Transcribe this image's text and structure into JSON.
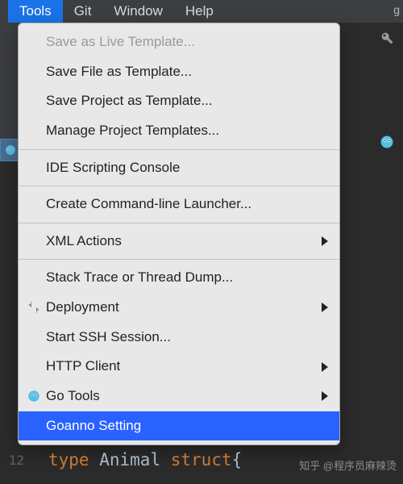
{
  "menubar": {
    "items": [
      {
        "label": "Tools",
        "active": true
      },
      {
        "label": "Git",
        "active": false
      },
      {
        "label": "Window",
        "active": false
      },
      {
        "label": "Help",
        "active": false
      }
    ]
  },
  "dropdown": {
    "items": [
      {
        "label": "Save as Live Template...",
        "disabled": true
      },
      {
        "label": "Save File as Template..."
      },
      {
        "label": "Save Project as Template..."
      },
      {
        "label": "Manage Project Templates..."
      },
      {
        "sep": true
      },
      {
        "label": "IDE Scripting Console"
      },
      {
        "sep": true
      },
      {
        "label": "Create Command-line Launcher..."
      },
      {
        "sep": true
      },
      {
        "label": "XML Actions",
        "submenu": true
      },
      {
        "sep": true
      },
      {
        "label": "Stack Trace or Thread Dump..."
      },
      {
        "label": "Deployment",
        "submenu": true,
        "icon": "deploy"
      },
      {
        "label": "Start SSH Session..."
      },
      {
        "label": "HTTP Client",
        "submenu": true
      },
      {
        "label": "Go Tools",
        "submenu": true,
        "icon": "gopher"
      },
      {
        "label": "Goanno Setting",
        "highlight": true
      }
    ]
  },
  "editor": {
    "line_number": "12",
    "code_kw1": "type",
    "code_ident": "Animal",
    "code_kw2": "struct",
    "brace": "{"
  },
  "watermark": "知乎 @程序员麻辣烫",
  "top_right_letter": "g"
}
